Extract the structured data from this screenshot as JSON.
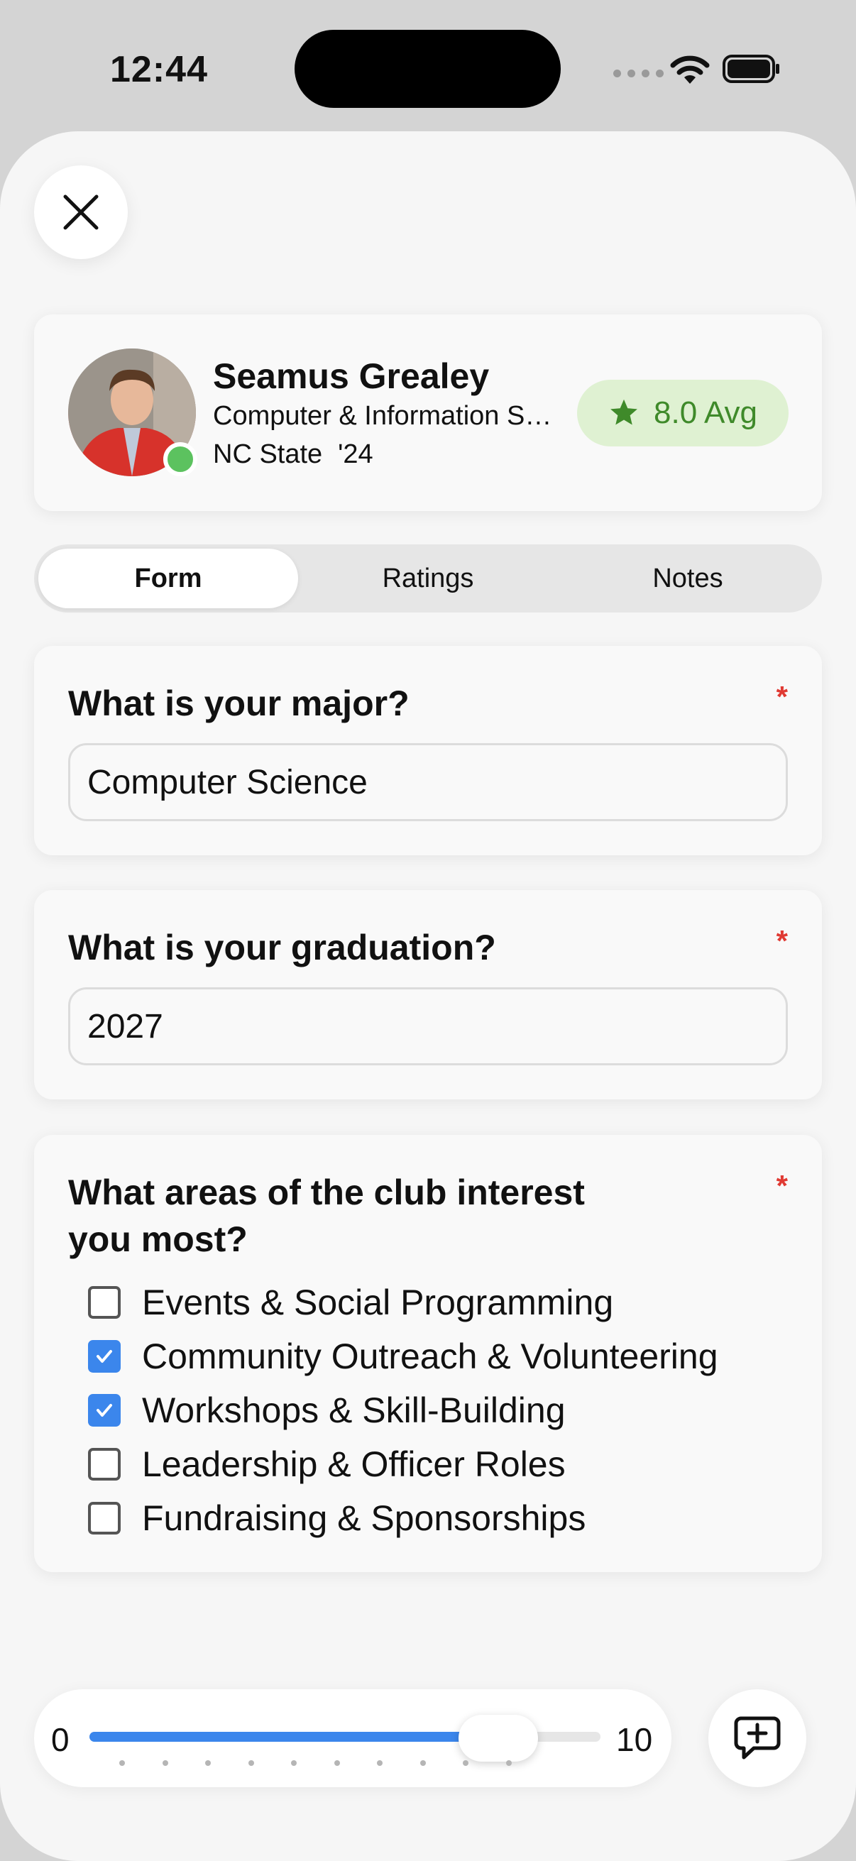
{
  "status_bar": {
    "time": "12:44"
  },
  "profile": {
    "name": "Seamus Grealey",
    "major": "Computer & Information Science",
    "school": "NC State",
    "year": "'24",
    "rating": "8.0 Avg",
    "online": true
  },
  "tabs": [
    {
      "label": "Form",
      "active": true
    },
    {
      "label": "Ratings",
      "active": false
    },
    {
      "label": "Notes",
      "active": false
    }
  ],
  "questions": [
    {
      "title": "What is your major?",
      "required": "*",
      "value": "Computer Science"
    },
    {
      "title": "What is your graduation?",
      "required": "*",
      "value": "2027"
    },
    {
      "title": "What areas of the club interest you most?",
      "required": "*",
      "options": [
        {
          "label": "Events & Social Programming",
          "checked": false
        },
        {
          "label": "Community Outreach & Volunteering",
          "checked": true
        },
        {
          "label": "Workshops & Skill-Building",
          "checked": true
        },
        {
          "label": "Leadership & Officer Roles",
          "checked": false
        },
        {
          "label": "Fundraising & Sponsorships",
          "checked": false
        }
      ]
    }
  ],
  "slider": {
    "min": "0",
    "max": "10",
    "value": 8,
    "ticks": 11
  },
  "colors": {
    "accent": "#3b86ec",
    "required": "#e03a33",
    "rating_bg": "#dff1d2",
    "rating_fg": "#3f8a2a",
    "online": "#5cc25f"
  },
  "icons": {
    "close": "close-icon",
    "star": "star-icon",
    "comment": "comment-add-icon"
  }
}
